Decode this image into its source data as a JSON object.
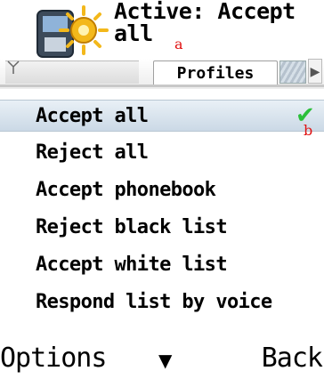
{
  "header": {
    "title": "Active: Accept all",
    "marker": "a",
    "icon": "phone-with-sun-icon"
  },
  "tabs": {
    "left_icon": "antenna-icon",
    "active_label": "Profiles",
    "right_arrow": "▶"
  },
  "list": {
    "items": [
      {
        "label": "Accept all",
        "selected": true
      },
      {
        "label": "Reject all"
      },
      {
        "label": "Accept phonebook"
      },
      {
        "label": "Reject black list"
      },
      {
        "label": "Accept white list"
      },
      {
        "label": "Respond list by voice"
      }
    ],
    "check_mark": "✔",
    "marker": "b"
  },
  "softkeys": {
    "left": "Options",
    "middle": "▼",
    "right": "Back"
  },
  "colors": {
    "selection": "#cbd9e6",
    "check": "#2bbf3a",
    "marker": "#e01010"
  }
}
